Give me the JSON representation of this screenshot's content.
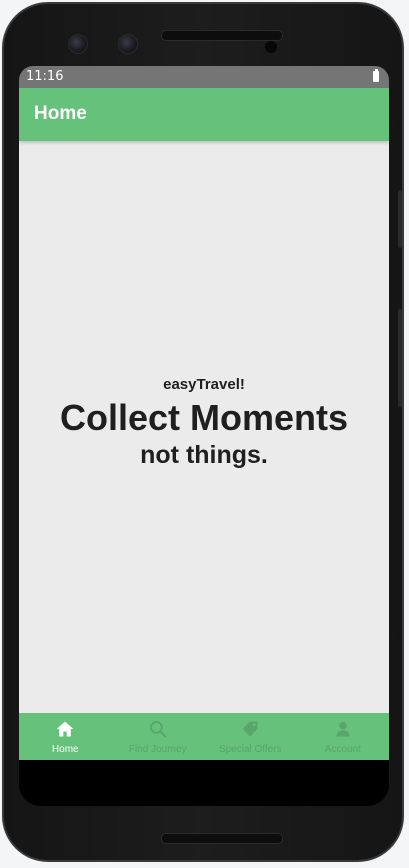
{
  "status_bar": {
    "time": "11:16",
    "icons": [
      "battery-icon"
    ]
  },
  "app_bar": {
    "title": "Home"
  },
  "hero": {
    "brand": "easyTravel!",
    "headline": "Collect Moments",
    "subline": "not things."
  },
  "bottom_nav": {
    "items": [
      {
        "label": "Home",
        "icon": "home-icon",
        "active": true
      },
      {
        "label": "Find Journey",
        "icon": "search-icon",
        "active": false
      },
      {
        "label": "Special Offers",
        "icon": "tag-icon",
        "active": false
      },
      {
        "label": "Account",
        "icon": "user-icon",
        "active": false
      }
    ]
  },
  "colors": {
    "accent_green": "#66c17a",
    "content_bg": "#ebebeb",
    "status_bar": "#757575",
    "inactive_icon": "#5aa56b"
  }
}
